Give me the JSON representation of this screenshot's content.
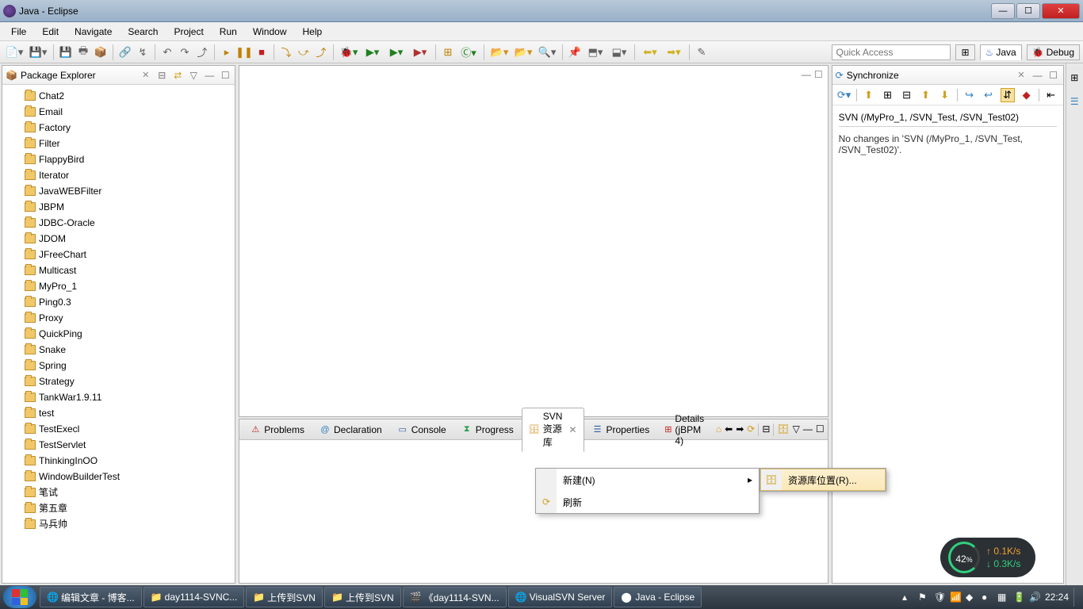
{
  "window": {
    "title": "Java - Eclipse"
  },
  "menu": [
    "File",
    "Edit",
    "Navigate",
    "Search",
    "Project",
    "Run",
    "Window",
    "Help"
  ],
  "quick_access_placeholder": "Quick Access",
  "perspectives": {
    "java": "Java",
    "debug": "Debug"
  },
  "package_explorer": {
    "title": "Package Explorer",
    "items": [
      "Chat2",
      "Email",
      "Factory",
      "Filter",
      "FlappyBird",
      "Iterator",
      "JavaWEBFilter",
      "JBPM",
      "JDBC-Oracle",
      "JDOM",
      "JFreeChart",
      "Multicast",
      "MyPro_1",
      "Ping0.3",
      "Proxy",
      "QuickPing",
      "Snake",
      "Spring",
      "Strategy",
      "TankWar1.9.11",
      "test",
      "TestExecl",
      "TestServlet",
      "ThinkingInOO",
      "WindowBuilderTest",
      "笔试",
      "第五章",
      "马兵帅"
    ]
  },
  "synchronize": {
    "title": "Synchronize",
    "header": "SVN (/MyPro_1, /SVN_Test, /SVN_Test02)",
    "message": "No changes in 'SVN (/MyPro_1, /SVN_Test, /SVN_Test02)'."
  },
  "bottom_tabs": {
    "problems": "Problems",
    "declaration": "Declaration",
    "console": "Console",
    "progress": "Progress",
    "svn_repo": "SVN 资源库",
    "properties": "Properties",
    "details": "Details (jBPM 4)"
  },
  "context_menu": {
    "new": "新建(N)",
    "refresh": "刷新",
    "sub_repo_location": "资源库位置(R)..."
  },
  "taskbar": {
    "items": [
      "编辑文章 - 博客...",
      "day1114-SVNC...",
      "上传到SVN",
      "上传到SVN",
      "《day1114-SVN...",
      "VisualSVN Server",
      "Java - Eclipse"
    ],
    "clock": "22:24"
  },
  "network": {
    "percent": "42",
    "up": "0.1K/s",
    "down": "0.3K/s"
  }
}
